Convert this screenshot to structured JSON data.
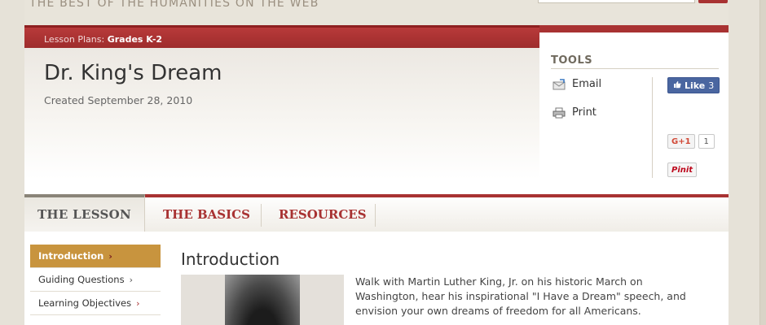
{
  "site": {
    "tagline": "THE BEST OF THE HUMANITIES ON THE WEB"
  },
  "breadcrumb": {
    "prefix": "Lesson Plans:",
    "current": "Grades K-2"
  },
  "page": {
    "title": "Dr. King's Dream",
    "created": "Created September 28, 2010"
  },
  "tools": {
    "heading": "TOOLS",
    "email_label": "Email",
    "print_label": "Print",
    "fb_like_label": "Like",
    "fb_like_count": "3",
    "gplus_label": "G+1",
    "gplus_count": "1",
    "pinit_label": "Pinit"
  },
  "tabs": [
    {
      "label": "THE LESSON",
      "active": true
    },
    {
      "label": "THE BASICS",
      "active": false
    },
    {
      "label": "RESOURCES",
      "active": false
    }
  ],
  "sidenav": [
    {
      "label": "Introduction",
      "active": true
    },
    {
      "label": "Guiding Questions",
      "active": false
    },
    {
      "label": "Learning Objectives",
      "active": false
    }
  ],
  "content": {
    "section_heading": "Introduction",
    "intro": "Walk with Martin Luther King, Jr. on his historic March on Washington, hear his inspirational \"I Have a Dream\" speech, and envision your own dreams of freedom for all Americans."
  },
  "colors": {
    "brand_red": "#a83232",
    "active_nav": "#c8943e",
    "background": "#e8e4da"
  }
}
